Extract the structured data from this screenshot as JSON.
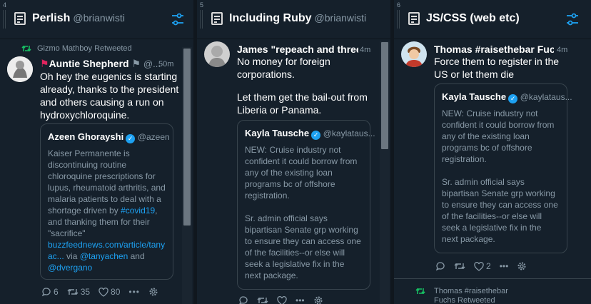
{
  "columns": [
    {
      "number": "4",
      "title": "Perlish",
      "handle": "@brianwisti",
      "tweet": {
        "retweet_label": "Gizmo Mathboy Retweeted",
        "author_name": "Auntie Shepherd",
        "author_handle": "@...",
        "time": "50m",
        "text": "Oh hey the eugenics is starting already, thanks to the president and others causing a run on hydroxychloroquine.",
        "quote": {
          "author_name": "Azeen Ghorayshi",
          "author_handle": "@azeen",
          "text": "Kaiser Permanente is discontinuing routine chloroquine prescriptions for lupus, rheumatoid arthritis, and malaria patients to deal with a shortage driven by",
          "hashtag": "#covid19",
          "text2": ", and thanking them for their \"sacrifice\"",
          "link": "buzzfeednews.com/article/tanyac...",
          "via_label": " via ",
          "mention1": "@tanyachen",
          "and_label": " and ",
          "mention2": "@dvergano"
        },
        "replies": "6",
        "retweets": "35",
        "likes": "80"
      }
    },
    {
      "number": "5",
      "title": "Including Ruby",
      "handle": "@brianwisti",
      "tweet": {
        "author_name": "James \"repeach and three...",
        "time": "4m",
        "text": "No money for foreign corporations.",
        "text2": "Let them get the bail-out from Liberia or Panama.",
        "quote": {
          "author_name": "Kayla Tausche",
          "author_handle": "@kaylataus...",
          "text": "NEW: Cruise industry not confident it could borrow from any of the existing loan programs bc of offshore registration.",
          "text2": "Sr. admin official says bipartisan Senate grp working to ensure they can access one of the facilities--or else will seek a legislative fix in the next package."
        }
      }
    },
    {
      "number": "6",
      "title": "JS/CSS (web etc)",
      "handle": "",
      "tweet": {
        "author_name": "Thomas #raisethebar Fuchs",
        "time": "4m",
        "text": "Force them to register in the US or let them die",
        "quote": {
          "author_name": "Kayla Tausche",
          "author_handle": "@kaylataus...",
          "text": "NEW: Cruise industry not confident it could borrow from any of the existing loan programs bc of offshore registration.",
          "text2": "Sr. admin official says bipartisan Senate grp working to ensure they can access one of the facilities--or else will seek a legislative fix in the next package."
        },
        "likes": "2"
      },
      "next_retweet": {
        "label": "Thomas #raisethebar Fuchs Retweeted"
      }
    }
  ],
  "colors": {
    "background": "#15202b",
    "accent": "#1da1f2",
    "retweet_green": "#17bf63",
    "muted_text": "#8899a6",
    "border": "#38444d"
  }
}
